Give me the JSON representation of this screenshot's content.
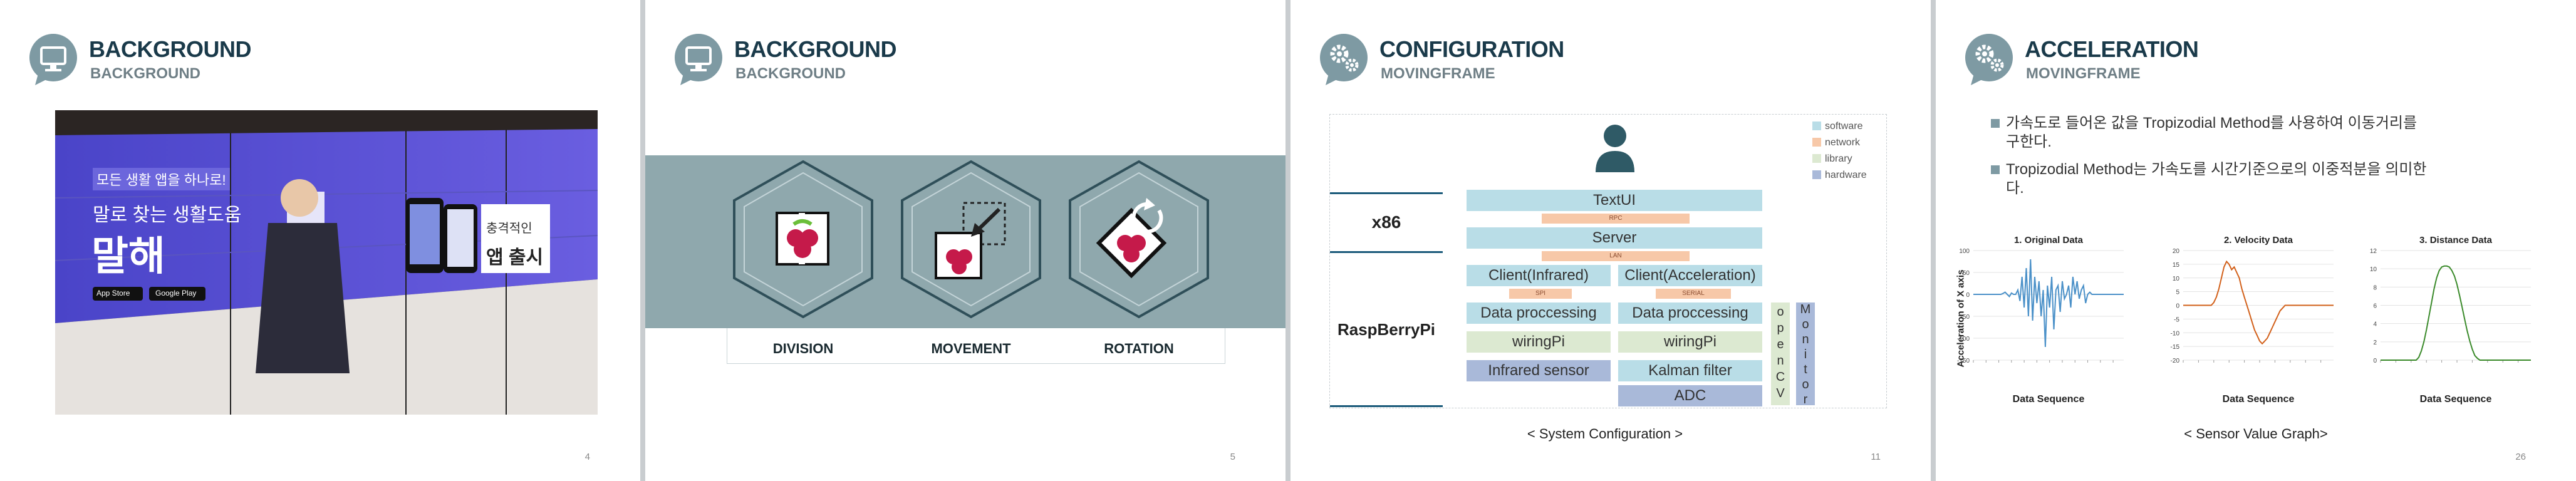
{
  "slides": [
    {
      "title": "BACKGROUND",
      "subtitle": "BACKGROUND",
      "page": "4",
      "icon": "monitor-icon",
      "photo": {
        "lines": [
          "모든 생활 앱을 하나로!",
          "말로 찾는 생활도움",
          "말해",
          "앱 출시",
          "충격적인"
        ],
        "stores": [
          "App Store",
          "Google Play"
        ]
      }
    },
    {
      "title": "BACKGROUND",
      "subtitle": "BACKGROUND",
      "page": "5",
      "icon": "monitor-icon",
      "items": [
        {
          "label": "DIVISION",
          "icon": "raspberry-split-icon"
        },
        {
          "label": "MOVEMENT",
          "icon": "raspberry-move-icon"
        },
        {
          "label": "ROTATION",
          "icon": "raspberry-rotate-icon"
        }
      ]
    },
    {
      "title": "CONFIGURATION",
      "subtitle": "MOVINGFRAME",
      "page": "11",
      "icon": "gears-icon",
      "platforms": [
        "x86",
        "RaspBerryPi"
      ],
      "legend": [
        {
          "label": "software",
          "color": "#b9dde7"
        },
        {
          "label": "network",
          "color": "#f7c8a8"
        },
        {
          "label": "library",
          "color": "#dce9d1"
        },
        {
          "label": "hardware",
          "color": "#a9b9d9"
        }
      ],
      "blocks": {
        "textui": "TextUI",
        "rpc": "RPC",
        "server": "Server",
        "lan": "LAN",
        "client_ir": "Client(Infrared)",
        "client_acc": "Client(Acceleration)",
        "spi": "SPI",
        "serial": "SERIAL",
        "dp1": "Data proccessing",
        "dp2": "Data proccessing",
        "wiring1": "wiringPi",
        "wiring2": "wiringPi",
        "infrared": "Infrared sensor",
        "kalman": "Kalman filter",
        "adc": "ADC",
        "opencv": "openCV",
        "monitor": "Monitor"
      },
      "caption": "< System Configuration >"
    },
    {
      "title": "ACCELERATION",
      "subtitle": "MOVINGFRAME",
      "page": "26",
      "icon": "gears-icon",
      "bullets": [
        {
          "line1": "가속도로 들어온 값을 Tropizodial Method를 사용하여 이동거리를",
          "line2": "구한다."
        },
        {
          "line1": "Tropizodial Method는 가속도를 시간기준으로의 이중적분을 의미한",
          "line2": "다."
        }
      ],
      "ylabel": "Acceleration of X axis",
      "caption": "< Sensor Value Graph>",
      "chart_data": [
        {
          "type": "line",
          "title": "1. Original Data",
          "xlabel": "Data  Sequence",
          "ylim": [
            -150,
            100
          ],
          "yticks": [
            100,
            50,
            0,
            -50,
            -100,
            -150
          ],
          "color": "#4a90c8",
          "values": [
            0,
            0,
            0,
            0,
            0,
            0,
            0,
            0,
            0,
            0,
            0,
            0,
            0,
            0,
            2,
            5,
            0,
            -5,
            3,
            0,
            0,
            10,
            -15,
            40,
            -30,
            60,
            -50,
            80,
            -60,
            40,
            -20,
            30,
            -50,
            10,
            -120,
            20,
            -30,
            40,
            -80,
            10,
            20,
            -40,
            30,
            -10,
            0,
            20,
            -30,
            40,
            0,
            30,
            -10,
            10,
            20,
            -20,
            0,
            5,
            0,
            0,
            0,
            0,
            0,
            0,
            0,
            0,
            0,
            0,
            0,
            0,
            0,
            0,
            0,
            0
          ]
        },
        {
          "type": "line",
          "title": "2. Velocity Data",
          "xlabel": "Data  Sequence",
          "ylim": [
            -20,
            20
          ],
          "yticks": [
            20,
            15,
            10,
            5,
            0,
            -5,
            -10,
            -15,
            -20
          ],
          "color": "#d2601a",
          "values": [
            0,
            0,
            0,
            0,
            0,
            0,
            0,
            0,
            0,
            0,
            0,
            0,
            1,
            3,
            6,
            10,
            14,
            16,
            15,
            13,
            14,
            12,
            10,
            6,
            3,
            0,
            -3,
            -6,
            -9,
            -11,
            -13,
            -14,
            -13,
            -12,
            -10,
            -8,
            -6,
            -4,
            -2,
            -1,
            0,
            0,
            0,
            0,
            0,
            0,
            0,
            0,
            0,
            0,
            0,
            0,
            0,
            0,
            0,
            0,
            0,
            0,
            0,
            0
          ]
        },
        {
          "type": "line",
          "title": "3. Distance Data",
          "xlabel": "Data  Sequence",
          "ylim": [
            0,
            12
          ],
          "yticks": [
            12,
            10,
            8,
            6,
            4,
            2,
            0
          ],
          "color": "#3a8a2a",
          "values": [
            0,
            0,
            0,
            0,
            0,
            0,
            0,
            0,
            0,
            0,
            0,
            0,
            0,
            0,
            0,
            0.3,
            1,
            2,
            3.3,
            4.8,
            6.3,
            7.8,
            9,
            9.8,
            10.2,
            10.3,
            10.3,
            10.2,
            9.8,
            9.2,
            8.3,
            7.1,
            5.8,
            4.5,
            3.2,
            2.1,
            1.2,
            0.5,
            0.2,
            0,
            0,
            0,
            0,
            0,
            0,
            0,
            0,
            0,
            0,
            0,
            0,
            0,
            0,
            0,
            0,
            0,
            0,
            0,
            0,
            0
          ]
        }
      ]
    }
  ]
}
